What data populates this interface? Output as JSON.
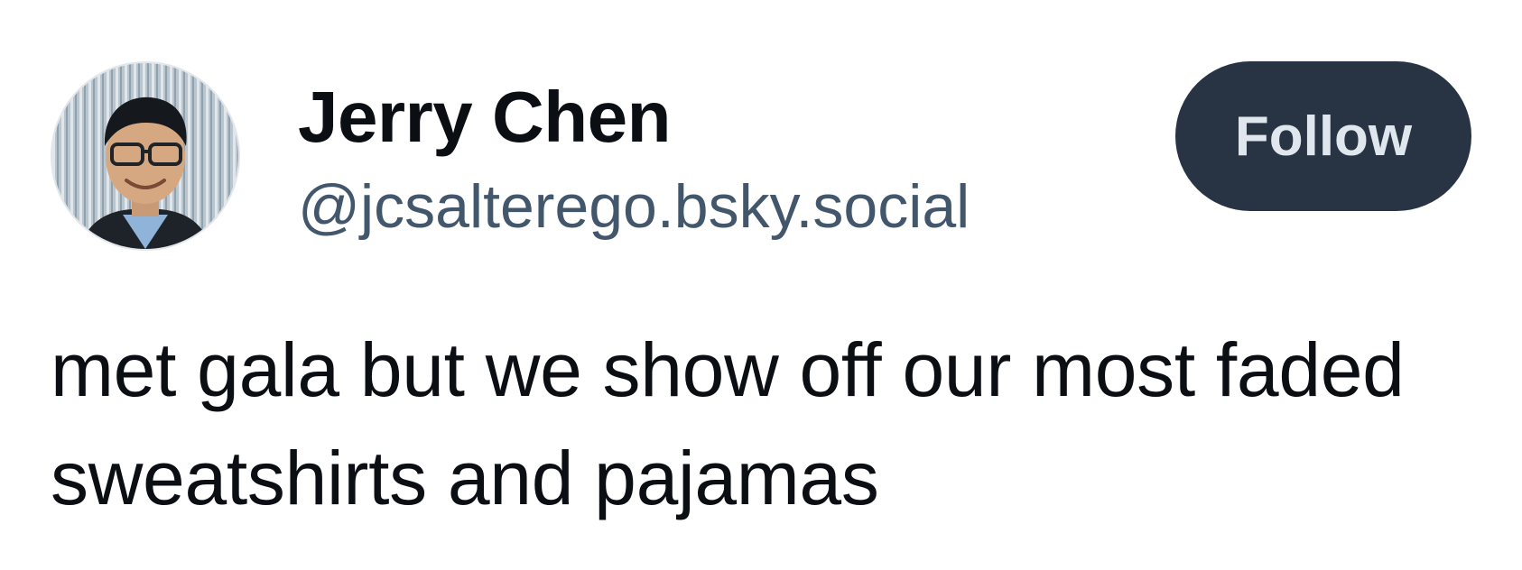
{
  "author": {
    "display_name": "Jerry Chen",
    "handle": "@jcsalterego.bsky.social"
  },
  "actions": {
    "follow_label": "Follow"
  },
  "post": {
    "text": "met gala but we show off our most faded sweatshirts and pajamas"
  },
  "colors": {
    "follow_background": "#283444",
    "follow_text": "#dfe6ee",
    "handle_text": "#42576c",
    "body_text": "#0b0f14"
  }
}
